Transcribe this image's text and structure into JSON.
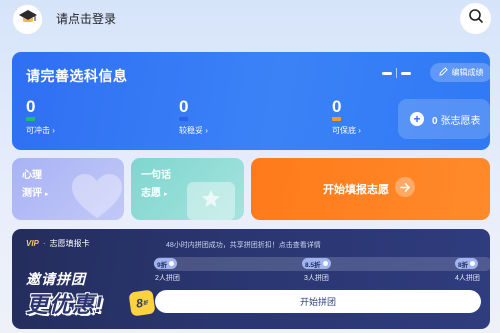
{
  "header": {
    "login_text": "请点击登录",
    "avatar_icon": "graduation-cap-icon",
    "search_icon": "search-icon"
  },
  "info_card": {
    "title": "请完善选科信息",
    "edit_label": "编辑成绩",
    "stats": [
      {
        "value": "0",
        "label": "可冲击",
        "color": "#1fbf6a"
      },
      {
        "value": "0",
        "label": "较稳妥",
        "color": "#2f6ff3"
      },
      {
        "value": "0",
        "label": "可保底",
        "color": "#ff9a1f"
      }
    ],
    "volunteer_count": "0",
    "volunteer_label": "张志愿表"
  },
  "tiles": {
    "psych_line1": "心理",
    "psych_line2": "测评",
    "wish_line1": "一句话",
    "wish_line2": "志愿",
    "fill_label": "开始填报志愿"
  },
  "vip": {
    "vip_text": "VIP",
    "dot": "·",
    "card_name": "志愿填报卡",
    "notice": "48小时内拼团成功，共享拼团折扣！点击查看详情",
    "promo_line1": "邀请拼团",
    "promo_line2": "更优惠!",
    "promo_badge": "8",
    "promo_badge_unit": "折",
    "tiers": [
      {
        "discount": "9折",
        "people": "2人拼团"
      },
      {
        "discount": "8.5折",
        "people": "3人拼团"
      },
      {
        "discount": "8折",
        "people": "4人拼团"
      }
    ],
    "button_label": "开始拼团"
  },
  "colors": {
    "primary": "#2f6ff3",
    "orange": "#ff7a1a",
    "navy": "#2a3670"
  }
}
